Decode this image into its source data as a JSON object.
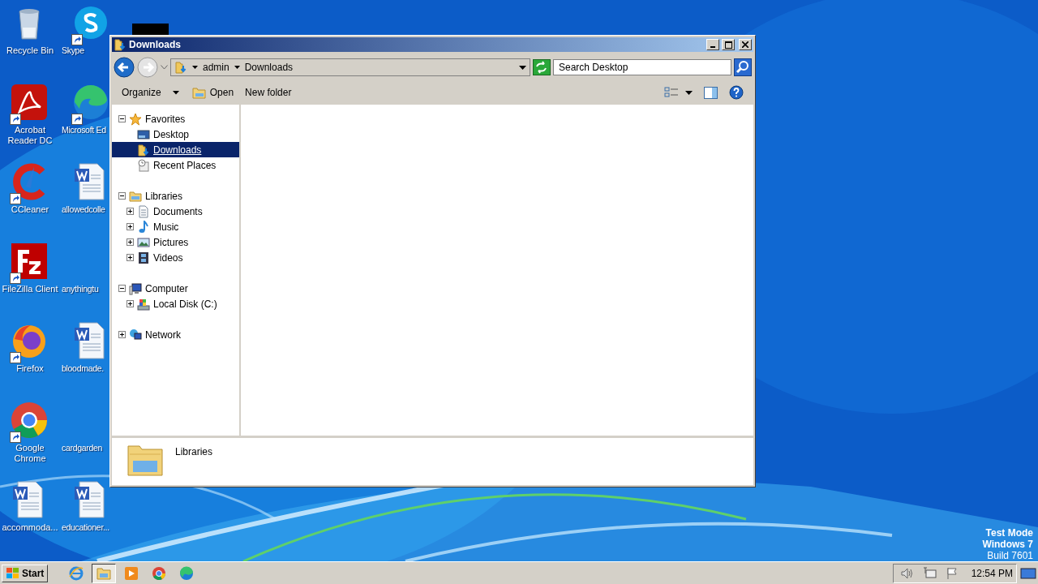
{
  "desktop_icons": [
    {
      "label": "Recycle Bin",
      "kind": "recycle-bin",
      "shortcut": false
    },
    {
      "label": "Acrobat Reader DC",
      "kind": "acrobat",
      "shortcut": true
    },
    {
      "label": "CCleaner",
      "kind": "ccleaner",
      "shortcut": true
    },
    {
      "label": "FileZilla Client",
      "kind": "filezilla",
      "shortcut": true
    },
    {
      "label": "Firefox",
      "kind": "firefox",
      "shortcut": true
    },
    {
      "label": "Google Chrome",
      "kind": "chrome",
      "shortcut": true
    },
    {
      "label": "accommoda...",
      "kind": "word",
      "shortcut": false
    },
    {
      "label": "Skype",
      "kind": "skype",
      "shortcut": true
    },
    {
      "label": "Microsoft Ed",
      "kind": "edge",
      "shortcut": true
    },
    {
      "label": "allowedcolle",
      "kind": "word",
      "shortcut": false
    },
    {
      "label": "anythingtu",
      "kind": "none",
      "shortcut": false
    },
    {
      "label": "bloodmade.",
      "kind": "word",
      "shortcut": false
    },
    {
      "label": "cardgarden",
      "kind": "none",
      "shortcut": false
    },
    {
      "label": "educationer...",
      "kind": "word",
      "shortcut": false
    }
  ],
  "window": {
    "title": "Downloads"
  },
  "address_bar": {
    "segments": [
      "admin",
      "Downloads"
    ]
  },
  "search": {
    "placeholder": "Search Desktop"
  },
  "toolbar": {
    "items": [
      {
        "label": "Organize",
        "kind": "menu"
      },
      {
        "label": "Open",
        "kind": "open"
      },
      {
        "label": "New folder",
        "kind": "plain"
      }
    ]
  },
  "navigation_pane": {
    "items": [
      {
        "label": "Favorites",
        "kind": "star",
        "selected": false,
        "expanded": true,
        "children": [
          {
            "label": "Desktop",
            "kind": "desktop",
            "selected": false
          },
          {
            "label": "Downloads",
            "kind": "downloads",
            "selected": true
          },
          {
            "label": "Recent Places",
            "kind": "recent",
            "selected": false
          }
        ]
      },
      {
        "label": "Libraries",
        "kind": "library",
        "selected": false,
        "expanded": true,
        "children": [
          {
            "label": "Documents",
            "kind": "documents",
            "selected": false,
            "expanded": false
          },
          {
            "label": "Music",
            "kind": "music",
            "selected": false,
            "expanded": false
          },
          {
            "label": "Pictures",
            "kind": "pictures",
            "selected": false,
            "expanded": false
          },
          {
            "label": "Videos",
            "kind": "videos",
            "selected": false,
            "expanded": false
          }
        ]
      },
      {
        "label": "Computer",
        "kind": "computer",
        "selected": false,
        "expanded": true,
        "children": [
          {
            "label": "Local Disk (C:)",
            "kind": "disk",
            "selected": false,
            "expanded": false
          }
        ]
      },
      {
        "label": "Network",
        "kind": "network",
        "selected": false,
        "expanded": false
      }
    ]
  },
  "details_pane": {
    "title": "Libraries"
  },
  "test_mode_notice": {
    "lines": [
      {
        "text": "Test Mode",
        "bold": true
      },
      {
        "text": "Windows 7",
        "bold": true
      },
      {
        "text": "Build 7601",
        "bold": false
      }
    ]
  },
  "taskbar": {
    "start": "Start",
    "buttons": [
      {
        "kind": "ie",
        "selected": false
      },
      {
        "kind": "explorer",
        "selected": true
      },
      {
        "kind": "media",
        "selected": false
      },
      {
        "kind": "chrome",
        "selected": false
      },
      {
        "kind": "edge",
        "selected": false
      }
    ],
    "clock": "12:54 PM"
  }
}
